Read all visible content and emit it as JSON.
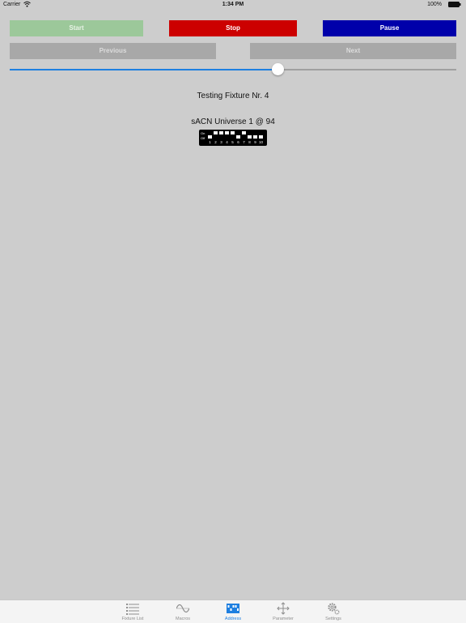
{
  "status_bar": {
    "carrier": "Carrier",
    "time": "1:34 PM",
    "battery": "100%"
  },
  "controls": {
    "start_label": "Start",
    "stop_label": "Stop",
    "pause_label": "Pause",
    "previous_label": "Previous",
    "next_label": "Next"
  },
  "slider": {
    "value": 0.6
  },
  "fixture": {
    "title": "Testing Fixture Nr. 4",
    "universe": "sACN Universe 1 @ 94"
  },
  "dip_switch": {
    "on_label": "On",
    "off_label": "Off",
    "numbers": [
      "1",
      "2",
      "3",
      "4",
      "5",
      "6",
      "7",
      "8",
      "9",
      "10"
    ],
    "states": [
      "off",
      "on",
      "on",
      "on",
      "on",
      "off",
      "on",
      "off",
      "off",
      "off"
    ]
  },
  "tabs": [
    {
      "label": "Fixture List",
      "icon": "list-icon",
      "active": false
    },
    {
      "label": "Macros",
      "icon": "sine-wave-icon",
      "active": false
    },
    {
      "label": "Address",
      "icon": "dip-switch-icon",
      "active": true
    },
    {
      "label": "Parameter",
      "icon": "move-arrows-icon",
      "active": false
    },
    {
      "label": "Settings",
      "icon": "gear-icon",
      "active": false
    }
  ],
  "colors": {
    "background": "#cdcdcd",
    "start": "#9cc89a",
    "stop": "#cc0000",
    "pause": "#0000aa",
    "accent": "#1e7fe0"
  }
}
